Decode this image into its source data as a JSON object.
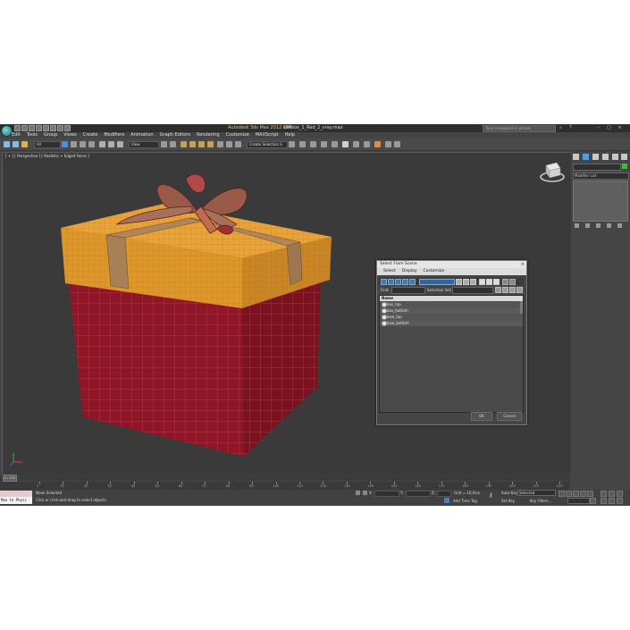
{
  "app": {
    "title": "Autodesk 3ds Max  2012 x64",
    "file": "Giftbox_1_Red_2_vray.max",
    "search_placeholder": "Type a keyword or phrase"
  },
  "menu": [
    "Edit",
    "Tools",
    "Group",
    "Views",
    "Create",
    "Modifiers",
    "Animation",
    "Graph Editors",
    "Rendering",
    "Customize",
    "MAXScript",
    "Help"
  ],
  "toolbar": {
    "filter_value": "All",
    "refcoord_value": "View",
    "selection_set_value": "Create Selection S"
  },
  "viewport": {
    "label": "[ + ] [ Perspective ] [ Realistic + Edged Faces ]",
    "colors": {
      "lid": "#e09a2e",
      "box": "#8e1626",
      "ribbon": "#a07a50"
    }
  },
  "command_panel": {
    "modifier_list": "Modifier List"
  },
  "dialog": {
    "title": "Select From Scene",
    "close": "×",
    "menu": [
      "Select",
      "Display",
      "Customize"
    ],
    "find_label": "Find:",
    "selection_set_label": "Selection Set:",
    "column_header": "Name",
    "objects": [
      "box_top",
      "box_bottom",
      "bow_top",
      "bow_bottom"
    ],
    "ok_label": "OK",
    "cancel_label": "Cancel"
  },
  "timeline": {
    "frame_indicator": "0 / 225",
    "ticks": [
      "0",
      "10",
      "20",
      "30",
      "40",
      "50",
      "60",
      "70",
      "80",
      "90",
      "100",
      "110",
      "120",
      "130",
      "140",
      "150",
      "160",
      "170",
      "180",
      "190",
      "200",
      "210",
      "220"
    ]
  },
  "status": {
    "maxscript_label": "Max to Physc",
    "selection_text": "None Selected",
    "prompt_text": "Click or click-and-drag to select objects",
    "grid_text": "Grid = 10,0cm",
    "autokey_label": "Auto Key",
    "setkey_label": "Set Key",
    "selected_value": "Selected",
    "key_filters": "Key Filters...",
    "add_time_tag": "Add Time Tag",
    "x_label": "X:",
    "y_label": "Y:",
    "z_label": "Z:"
  }
}
